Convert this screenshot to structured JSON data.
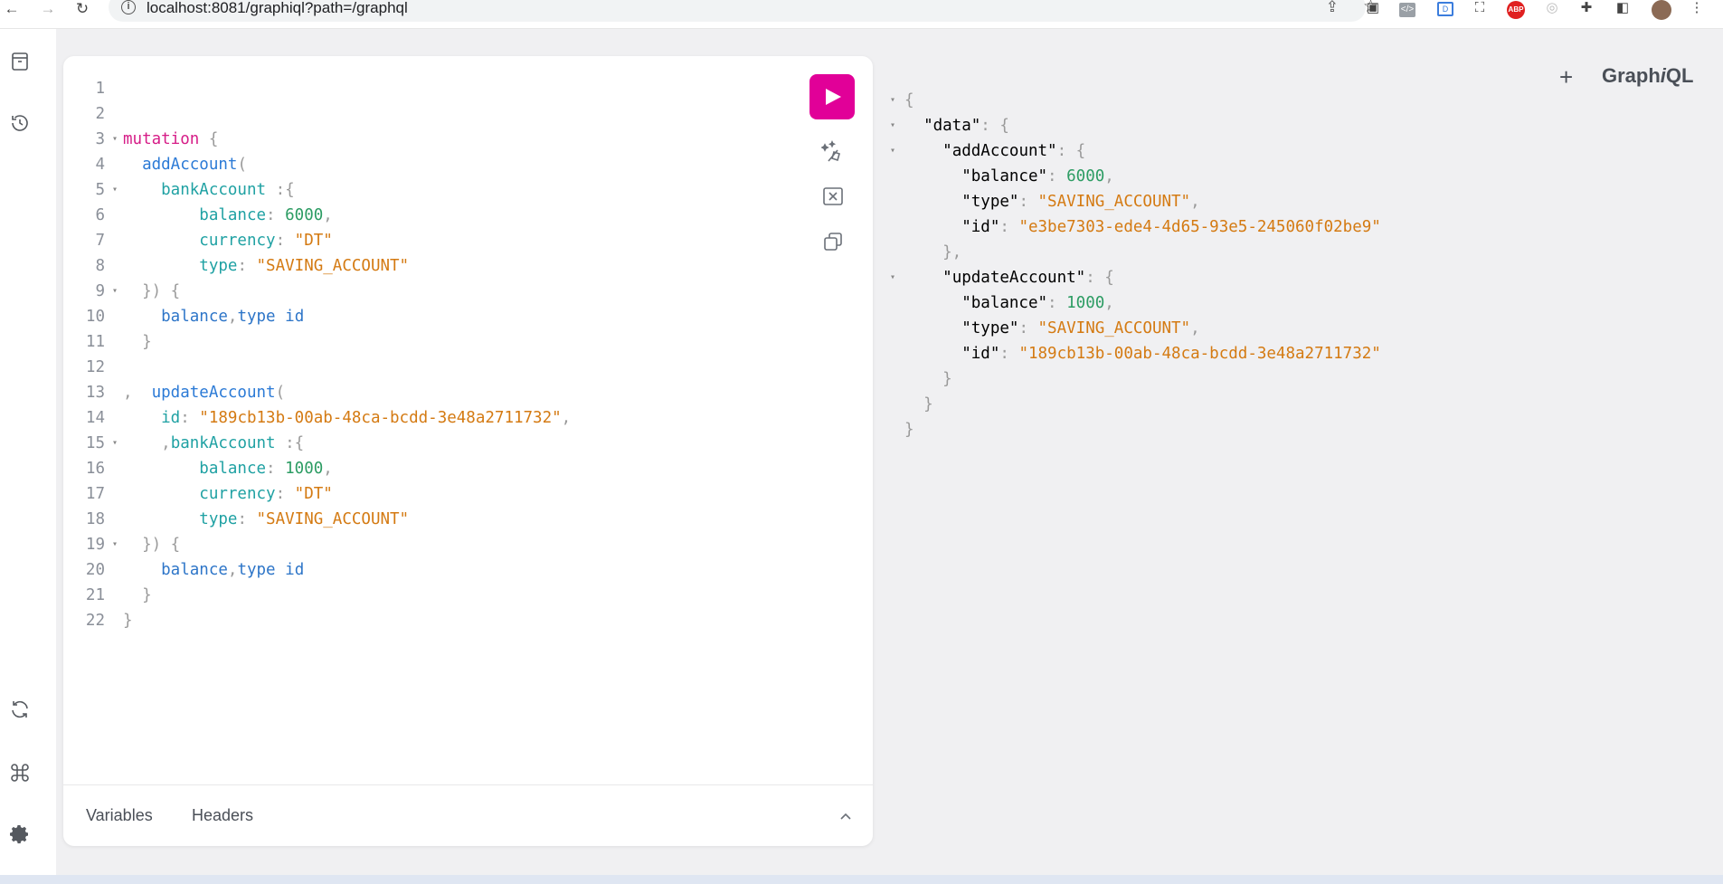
{
  "browser": {
    "url": "localhost:8081/graphiql?path=/graphql",
    "extensions": [
      "picture-in-picture-icon",
      "code-icon",
      "vue-devtools-icon",
      "screenshot-icon",
      "adblock-icon",
      "extension-ghost-icon",
      "puzzle-icon",
      "sidepanel-icon",
      "profile-avatar-icon",
      "kebab-menu-icon"
    ],
    "adblock_label": "ABP"
  },
  "sidebar": {
    "top_icons": [
      "docs-icon",
      "history-icon"
    ],
    "bottom_icons": [
      "refresh-icon",
      "shortcut-icon",
      "settings-icon"
    ]
  },
  "editor": {
    "lines": [
      {
        "n": "1",
        "fold": false,
        "tokens": []
      },
      {
        "n": "2",
        "fold": false,
        "tokens": []
      },
      {
        "n": "3",
        "fold": true,
        "tokens": [
          {
            "t": "mutation",
            "c": "kw"
          },
          {
            "t": " {",
            "c": "p"
          }
        ]
      },
      {
        "n": "4",
        "fold": false,
        "tokens": [
          {
            "t": "  addAccount",
            "c": "def"
          },
          {
            "t": "(",
            "c": "p"
          }
        ]
      },
      {
        "n": "5",
        "fold": true,
        "tokens": [
          {
            "t": "    bankAccount",
            "c": "arg"
          },
          {
            "t": " :{",
            "c": "p"
          }
        ]
      },
      {
        "n": "6",
        "fold": false,
        "tokens": [
          {
            "t": "        balance",
            "c": "arg"
          },
          {
            "t": ": ",
            "c": "p"
          },
          {
            "t": "6000",
            "c": "num"
          },
          {
            "t": ",",
            "c": "p"
          }
        ]
      },
      {
        "n": "7",
        "fold": false,
        "tokens": [
          {
            "t": "        currency",
            "c": "arg"
          },
          {
            "t": ": ",
            "c": "p"
          },
          {
            "t": "\"DT\"",
            "c": "str"
          }
        ]
      },
      {
        "n": "8",
        "fold": false,
        "tokens": [
          {
            "t": "        type",
            "c": "arg"
          },
          {
            "t": ": ",
            "c": "p"
          },
          {
            "t": "\"SAVING_ACCOUNT\"",
            "c": "str"
          }
        ]
      },
      {
        "n": "9",
        "fold": true,
        "tokens": [
          {
            "t": "  }) {",
            "c": "p"
          }
        ]
      },
      {
        "n": "10",
        "fold": false,
        "tokens": [
          {
            "t": "    balance",
            "c": "field"
          },
          {
            "t": ",",
            "c": "p"
          },
          {
            "t": "type",
            "c": "field"
          },
          {
            "t": " ",
            "c": "p"
          },
          {
            "t": "id",
            "c": "field"
          }
        ]
      },
      {
        "n": "11",
        "fold": false,
        "tokens": [
          {
            "t": "  }",
            "c": "p"
          }
        ]
      },
      {
        "n": "12",
        "fold": false,
        "tokens": []
      },
      {
        "n": "13",
        "fold": false,
        "tokens": [
          {
            "t": ",  ",
            "c": "p"
          },
          {
            "t": "updateAccount",
            "c": "def"
          },
          {
            "t": "(",
            "c": "p"
          }
        ]
      },
      {
        "n": "14",
        "fold": false,
        "tokens": [
          {
            "t": "    id",
            "c": "arg"
          },
          {
            "t": ": ",
            "c": "p"
          },
          {
            "t": "\"189cb13b-00ab-48ca-bcdd-3e48a2711732\"",
            "c": "str"
          },
          {
            "t": ",",
            "c": "p"
          }
        ]
      },
      {
        "n": "15",
        "fold": true,
        "tokens": [
          {
            "t": "    ,",
            "c": "p"
          },
          {
            "t": "bankAccount",
            "c": "arg"
          },
          {
            "t": " :{",
            "c": "p"
          }
        ]
      },
      {
        "n": "16",
        "fold": false,
        "tokens": [
          {
            "t": "        balance",
            "c": "arg"
          },
          {
            "t": ": ",
            "c": "p"
          },
          {
            "t": "1000",
            "c": "num"
          },
          {
            "t": ",",
            "c": "p"
          }
        ]
      },
      {
        "n": "17",
        "fold": false,
        "tokens": [
          {
            "t": "        currency",
            "c": "arg"
          },
          {
            "t": ": ",
            "c": "p"
          },
          {
            "t": "\"DT\"",
            "c": "str"
          }
        ]
      },
      {
        "n": "18",
        "fold": false,
        "tokens": [
          {
            "t": "        type",
            "c": "arg"
          },
          {
            "t": ": ",
            "c": "p"
          },
          {
            "t": "\"SAVING_ACCOUNT\"",
            "c": "str"
          }
        ]
      },
      {
        "n": "19",
        "fold": true,
        "tokens": [
          {
            "t": "  }) {",
            "c": "p"
          }
        ]
      },
      {
        "n": "20",
        "fold": false,
        "tokens": [
          {
            "t": "    balance",
            "c": "field"
          },
          {
            "t": ",",
            "c": "p"
          },
          {
            "t": "type",
            "c": "field"
          },
          {
            "t": " ",
            "c": "p"
          },
          {
            "t": "id",
            "c": "field"
          }
        ]
      },
      {
        "n": "21",
        "fold": false,
        "tokens": [
          {
            "t": "  }",
            "c": "p"
          }
        ]
      },
      {
        "n": "22",
        "fold": false,
        "tokens": [
          {
            "t": "}",
            "c": "p"
          }
        ]
      }
    ],
    "toolbar": [
      "run-icon",
      "prettify-icon",
      "merge-fragments-icon",
      "copy-icon"
    ],
    "bottom_tabs": {
      "variables": "Variables",
      "headers": "Headers"
    }
  },
  "result": {
    "lines": [
      {
        "fold": true,
        "tokens": [
          {
            "t": "{",
            "c": "p"
          }
        ]
      },
      {
        "fold": true,
        "tokens": [
          {
            "t": "  ",
            "c": "p"
          },
          {
            "t": "\"data\"",
            "c": "key"
          },
          {
            "t": ": {",
            "c": "p"
          }
        ]
      },
      {
        "fold": true,
        "tokens": [
          {
            "t": "    ",
            "c": "p"
          },
          {
            "t": "\"addAccount\"",
            "c": "key"
          },
          {
            "t": ": {",
            "c": "p"
          }
        ]
      },
      {
        "fold": false,
        "tokens": [
          {
            "t": "      ",
            "c": "p"
          },
          {
            "t": "\"balance\"",
            "c": "key"
          },
          {
            "t": ": ",
            "c": "p"
          },
          {
            "t": "6000",
            "c": "num"
          },
          {
            "t": ",",
            "c": "p"
          }
        ]
      },
      {
        "fold": false,
        "tokens": [
          {
            "t": "      ",
            "c": "p"
          },
          {
            "t": "\"type\"",
            "c": "key"
          },
          {
            "t": ": ",
            "c": "p"
          },
          {
            "t": "\"SAVING_ACCOUNT\"",
            "c": "str"
          },
          {
            "t": ",",
            "c": "p"
          }
        ]
      },
      {
        "fold": false,
        "tokens": [
          {
            "t": "      ",
            "c": "p"
          },
          {
            "t": "\"id\"",
            "c": "key"
          },
          {
            "t": ": ",
            "c": "p"
          },
          {
            "t": "\"e3be7303-ede4-4d65-93e5-245060f02be9\"",
            "c": "str"
          }
        ]
      },
      {
        "fold": false,
        "tokens": [
          {
            "t": "    },",
            "c": "p"
          }
        ]
      },
      {
        "fold": true,
        "tokens": [
          {
            "t": "    ",
            "c": "p"
          },
          {
            "t": "\"updateAccount\"",
            "c": "key"
          },
          {
            "t": ": {",
            "c": "p"
          }
        ]
      },
      {
        "fold": false,
        "tokens": [
          {
            "t": "      ",
            "c": "p"
          },
          {
            "t": "\"balance\"",
            "c": "key"
          },
          {
            "t": ": ",
            "c": "p"
          },
          {
            "t": "1000",
            "c": "num"
          },
          {
            "t": ",",
            "c": "p"
          }
        ]
      },
      {
        "fold": false,
        "tokens": [
          {
            "t": "      ",
            "c": "p"
          },
          {
            "t": "\"type\"",
            "c": "key"
          },
          {
            "t": ": ",
            "c": "p"
          },
          {
            "t": "\"SAVING_ACCOUNT\"",
            "c": "str"
          },
          {
            "t": ",",
            "c": "p"
          }
        ]
      },
      {
        "fold": false,
        "tokens": [
          {
            "t": "      ",
            "c": "p"
          },
          {
            "t": "\"id\"",
            "c": "key"
          },
          {
            "t": ": ",
            "c": "p"
          },
          {
            "t": "\"189cb13b-00ab-48ca-bcdd-3e48a2711732\"",
            "c": "str"
          }
        ]
      },
      {
        "fold": false,
        "tokens": [
          {
            "t": "    }",
            "c": "p"
          }
        ]
      },
      {
        "fold": false,
        "tokens": [
          {
            "t": "  }",
            "c": "p"
          }
        ]
      },
      {
        "fold": false,
        "tokens": [
          {
            "t": "}",
            "c": "p"
          }
        ]
      }
    ]
  },
  "header": {
    "add_tab": "+",
    "brand_prefix": "Graph",
    "brand_i": "i",
    "brand_suffix": "QL"
  },
  "colors": {
    "accent": "#e10098",
    "keyword": "#d61c87",
    "def": "#2b7ad6",
    "arg": "#1fa1a3",
    "string": "#d47a12",
    "number": "#2c9c63"
  }
}
